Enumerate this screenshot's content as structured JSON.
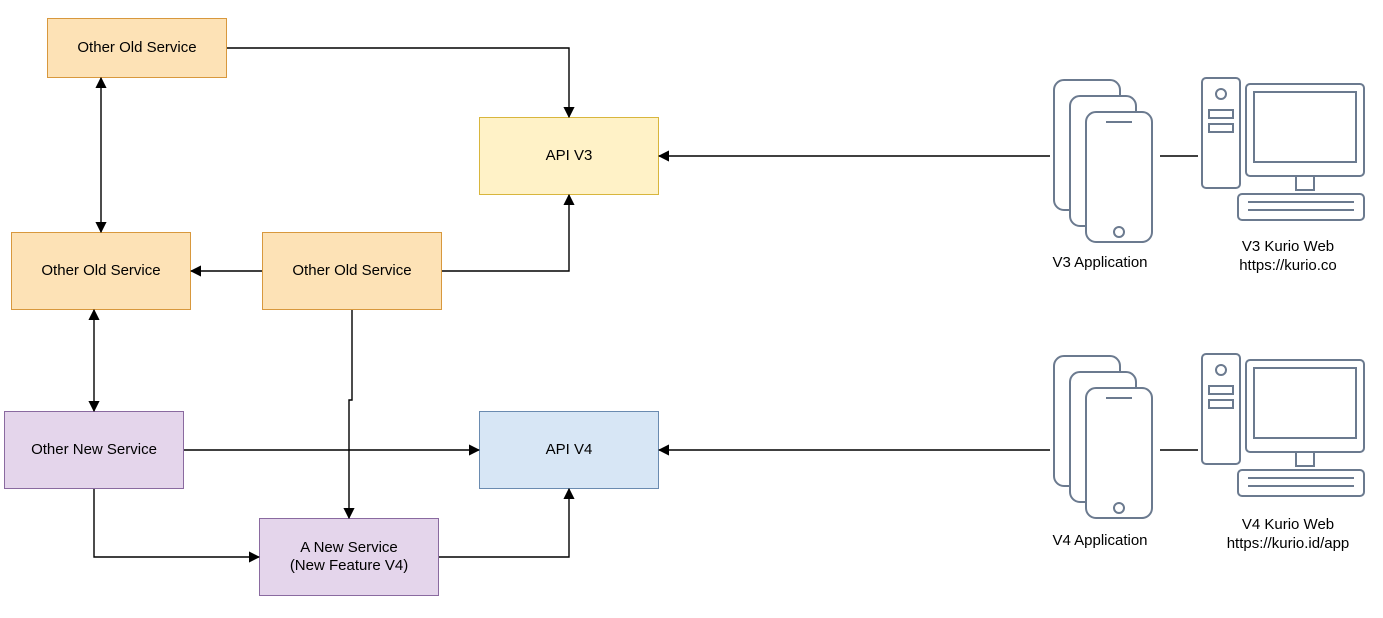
{
  "boxes": {
    "old1": "Other Old Service",
    "old2": "Other Old Service",
    "old3": "Other Old Service",
    "api3": "API V3",
    "new1": "Other New Service",
    "new2_line1": "A New Service",
    "new2_line2": "(New Feature V4)",
    "api4": "API V4"
  },
  "labels": {
    "v3app": "V3 Application",
    "v3web_line1": "V3 Kurio Web",
    "v3web_line2": "https://kurio.co",
    "v4app": "V4 Application",
    "v4web_line1": "V4 Kurio Web",
    "v4web_line2": "https://kurio.id/app"
  },
  "chart_data": {
    "type": "diagram",
    "title": "",
    "nodes": [
      {
        "id": "old_top",
        "label": "Other Old Service",
        "group": "v3-service"
      },
      {
        "id": "old_left",
        "label": "Other Old Service",
        "group": "v3-service"
      },
      {
        "id": "old_mid",
        "label": "Other Old Service",
        "group": "v3-service"
      },
      {
        "id": "api_v3",
        "label": "API V3",
        "group": "v3-api"
      },
      {
        "id": "new_left",
        "label": "Other New Service",
        "group": "v4-service"
      },
      {
        "id": "new_feature",
        "label": "A New Service (New Feature V4)",
        "group": "v4-service"
      },
      {
        "id": "api_v4",
        "label": "API V4",
        "group": "v4-api"
      },
      {
        "id": "v3_app",
        "label": "V3 Application",
        "group": "client-mobile"
      },
      {
        "id": "v3_web",
        "label": "V3 Kurio Web https://kurio.co",
        "group": "client-desktop"
      },
      {
        "id": "v4_app",
        "label": "V4 Application",
        "group": "client-mobile"
      },
      {
        "id": "v4_web",
        "label": "V4 Kurio Web https://kurio.id/app",
        "group": "client-desktop"
      }
    ],
    "edges": [
      {
        "from": "old_top",
        "to": "api_v3"
      },
      {
        "from": "old_mid",
        "to": "api_v3"
      },
      {
        "from": "old_mid",
        "to": "old_left"
      },
      {
        "from": "old_left",
        "to": "old_top",
        "bidirectional": true
      },
      {
        "from": "old_left",
        "to": "new_left",
        "bidirectional": true
      },
      {
        "from": "old_mid",
        "to": "new_feature"
      },
      {
        "from": "new_left",
        "to": "new_feature"
      },
      {
        "from": "new_left",
        "to": "api_v4"
      },
      {
        "from": "new_feature",
        "to": "api_v4"
      },
      {
        "from": "v3_app",
        "to": "api_v3"
      },
      {
        "from": "v3_web",
        "to": "api_v3"
      },
      {
        "from": "v4_app",
        "to": "api_v4"
      },
      {
        "from": "v4_web",
        "to": "api_v4"
      }
    ]
  }
}
